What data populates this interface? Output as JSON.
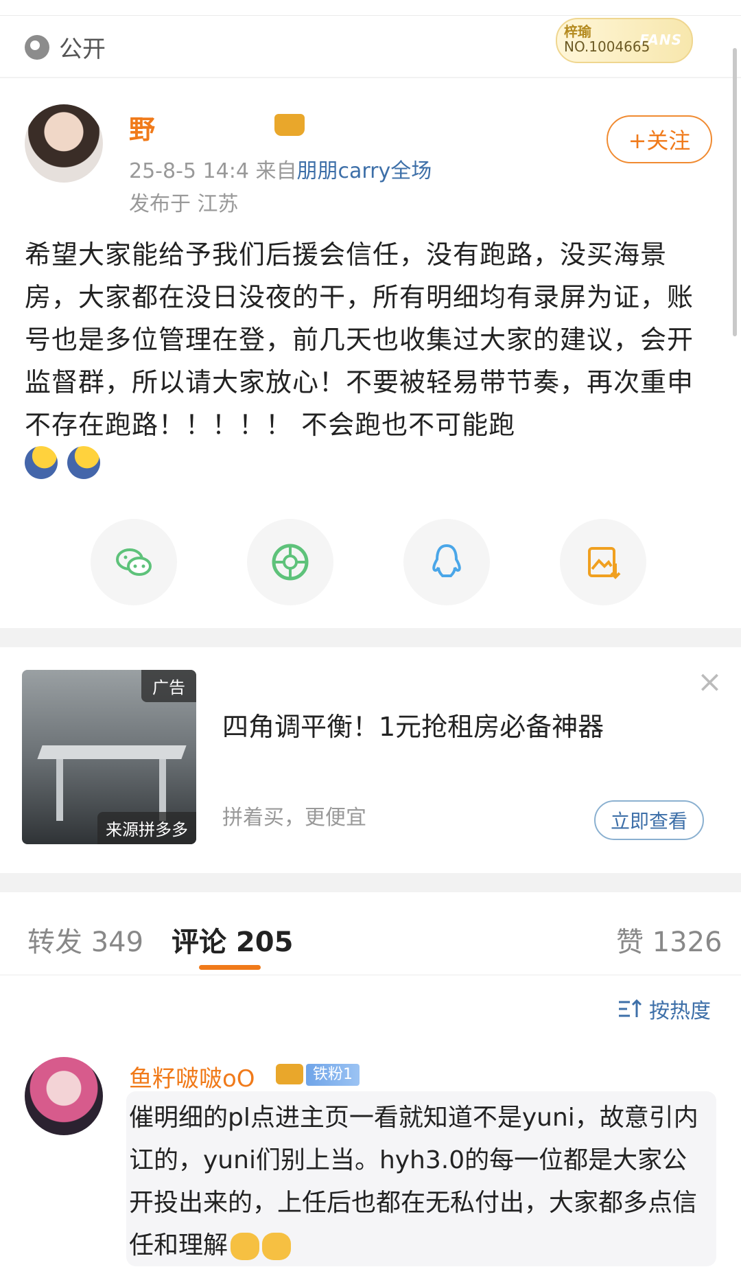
{
  "header": {
    "visibility_label": "公开",
    "fans_badge_line1": "梓瑜",
    "fans_badge_line2": "NO.1004665",
    "fans_badge_word": "FANS"
  },
  "author": {
    "name": "野",
    "timestamp": "25-8-5 14:4",
    "source_prefix": "来自",
    "source": "朋朋carry全场",
    "location": "发布于 江苏",
    "follow_label": "+关注"
  },
  "post": {
    "text": "希望大家能给予我们后援会信任，没有跑路，没买海景房，大家都在没日没夜的干，所有明细均有录屏为证，账号也是多位管理在登，前几天也收集过大家的建议，会开监督群，所以请大家放心！不要被轻易带节奏，再次重申不存在跑路！！！！！ 不会跑也不可能跑"
  },
  "share": {
    "icons": [
      "wechat-icon",
      "moments-icon",
      "qq-icon",
      "save-image-icon"
    ]
  },
  "ad": {
    "tag": "广告",
    "source_label": "来源拼多多",
    "title": "四角调平衡！1元抢租房必备神器",
    "subtitle": "拼着买，更便宜",
    "button_label": "立即查看",
    "close_glyph": "×"
  },
  "tabs": {
    "repost": "转发 349",
    "comment": "评论 205",
    "like": "赞 1326"
  },
  "sort_label": "按热度",
  "comment": {
    "name": "鱼籽啵啵oO",
    "badge": "铁粉1",
    "text": "催明细的pl点进主页一看就知道不是yuni，故意引内讧的，yuni们别上当。hyh3.0的每一位都是大家公开投出来的，上任后也都在无私付出，大家都多点信任和理解"
  },
  "colors": {
    "accent": "#f07a1a",
    "link": "#3d6fa8",
    "wechat": "#5ec27a",
    "qq": "#4aa6e8",
    "save": "#f0a020"
  }
}
